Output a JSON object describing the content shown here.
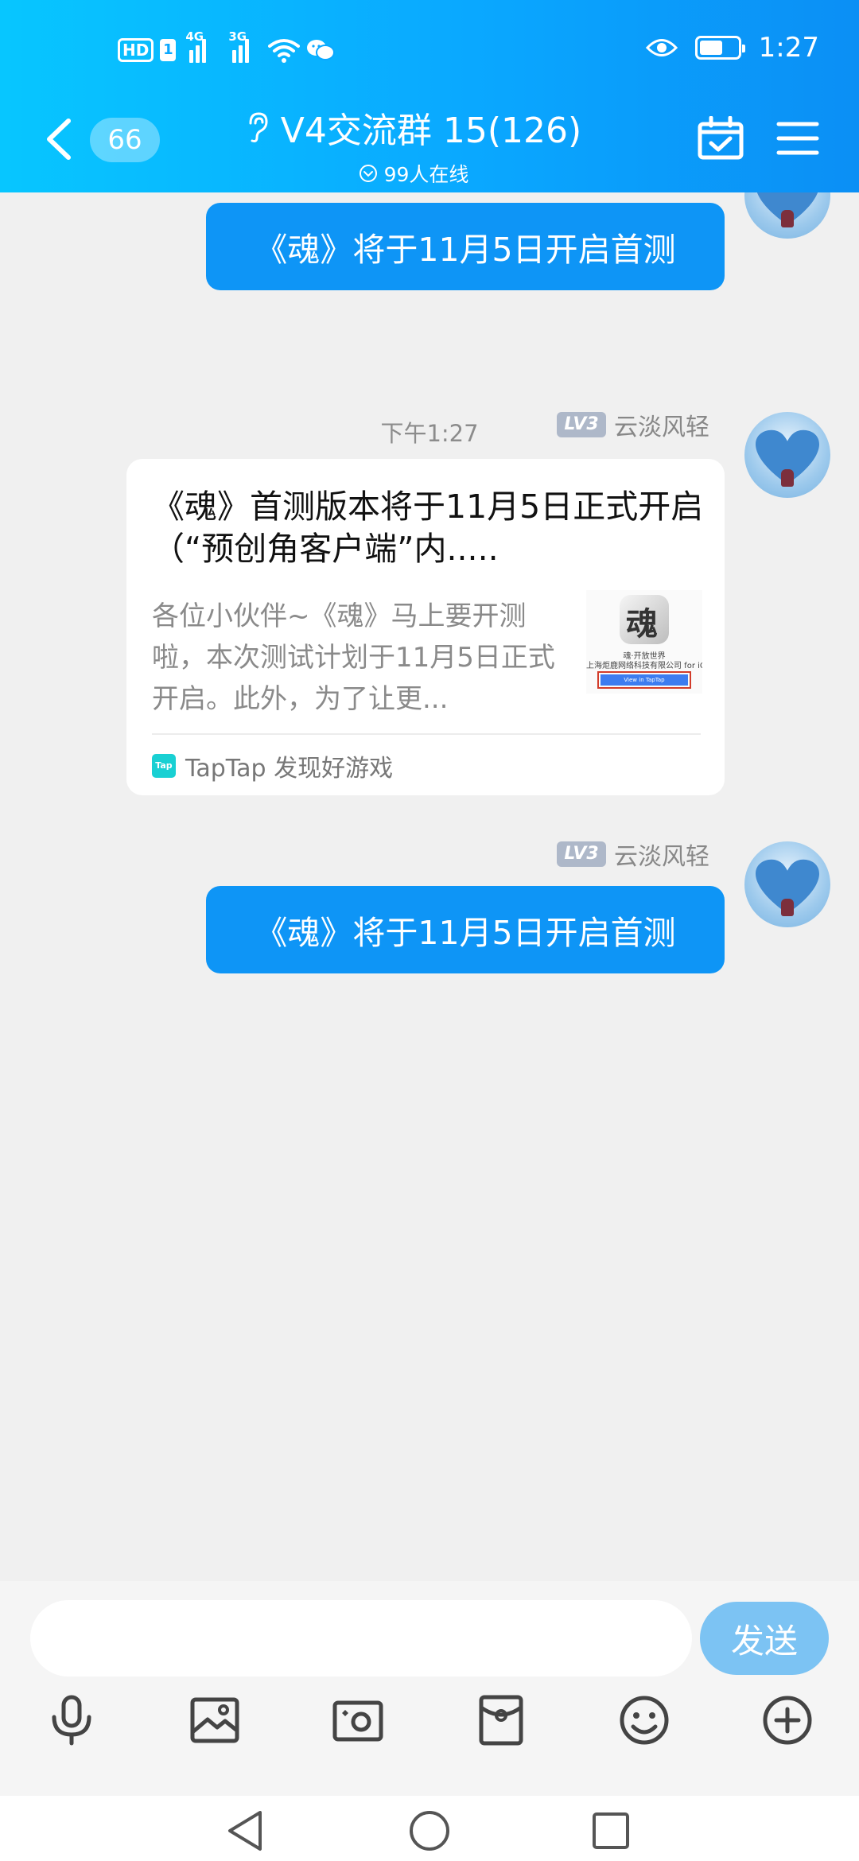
{
  "status_bar": {
    "time": "1:27",
    "hd": "HD",
    "sim": "1",
    "network_1": "4G",
    "network_2": "3G"
  },
  "header": {
    "unread_count": "66",
    "title": "V4交流群 15(126)",
    "online": "99人在线"
  },
  "chat": {
    "top_partial_message": "《魂》将于11月5日开启首测",
    "time_separator": "下午1:27",
    "messages": [
      {
        "sender_level": "LV3",
        "sender_name": "云淡风轻",
        "card": {
          "title": "《魂》首测版本将于11月5日正式开启（“预创角客户端”内.....",
          "description": "各位小伙伴~《魂》马上要开测啦，本次测试计划于11月5日正式开启。此外，为了让更...",
          "thumb_caption_1": "魂·开放世界",
          "thumb_caption_2": "上海炬鹿网络科技有限公司 for iOS",
          "thumb_button": "View in TapTap",
          "source_logo": "Tap",
          "source": "TapTap 发现好游戏"
        }
      },
      {
        "sender_level": "LV3",
        "sender_name": "云淡风轻",
        "text": "《魂》将于11月5日开启首测"
      }
    ]
  },
  "input": {
    "placeholder": "",
    "value": "",
    "send_label": "发送"
  },
  "toolbar": [
    "microphone-icon",
    "gallery-icon",
    "camera-icon",
    "red-packet-icon",
    "emoji-icon",
    "plus-icon"
  ],
  "colors": {
    "header_start": "#07c6ff",
    "header_end": "#0b8ff5",
    "bubble": "#0e95f6",
    "send_button": "#7cc3f3",
    "chat_background": "#f0f0f0"
  }
}
